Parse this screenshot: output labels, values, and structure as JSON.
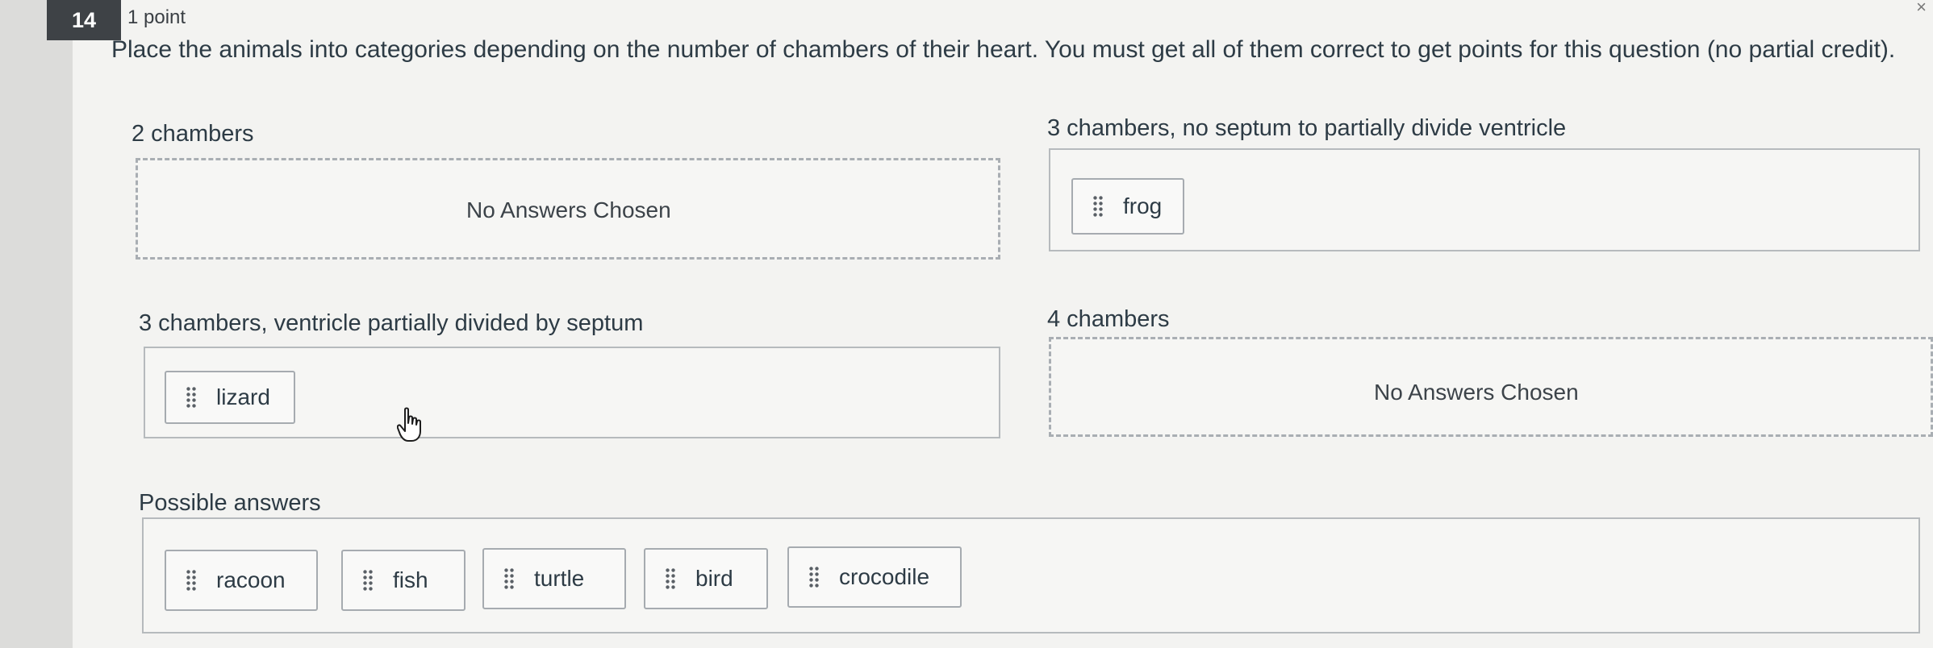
{
  "question": {
    "number": "14",
    "points": "1 point",
    "prompt": "Place the animals into categories depending on the number of chambers of their heart.  You must get all of them correct to get points for this question (no partial credit)."
  },
  "categories": [
    {
      "label": "2 chambers",
      "items": [],
      "empty_text": "No Answers Chosen"
    },
    {
      "label": "3 chambers, no septum to partially divide ventricle",
      "items": [
        "frog"
      ]
    },
    {
      "label": "3 chambers, ventricle partially divided by septum",
      "items": [
        "lizard"
      ]
    },
    {
      "label": "4 chambers",
      "items": [],
      "empty_text": "No Answers Chosen"
    }
  ],
  "possible_answers": {
    "label": "Possible answers",
    "items": [
      "racoon",
      "fish",
      "turtle",
      "bird",
      "crocodile"
    ]
  },
  "icons": {
    "drag_handle": "grip-vertical-icon",
    "cursor": "hand-pointer-icon"
  }
}
